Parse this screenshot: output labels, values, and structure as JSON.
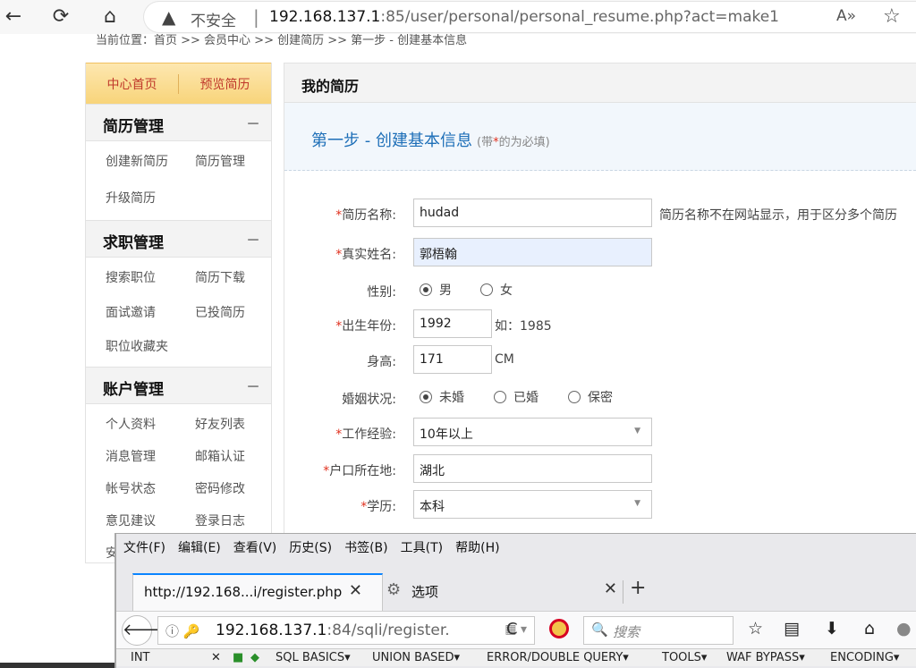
{
  "edge": {
    "back": "←",
    "refresh": "⟳",
    "home": "⌂",
    "warning": "▲",
    "insecure": "不安全",
    "separator": "|",
    "url_host": "192.168.137.1",
    "url_rest": ":85/user/personal/personal_resume.php?act=make1",
    "read_aloud": "A»",
    "favorite": "☆"
  },
  "breadcrumb": "当前位置：首页 >> 会员中心 >> 创建简历 >> 第一步 - 创建基本信息",
  "sidebar": {
    "top_links": [
      "中心首页",
      "预览简历"
    ],
    "sections": [
      {
        "title": "简历管理",
        "toggle": "－",
        "items": [
          "创建新简历",
          "简历管理",
          "升级简历"
        ]
      },
      {
        "title": "求职管理",
        "toggle": "－",
        "items": [
          "搜索职位",
          "简历下载",
          "面试邀请",
          "已投简历",
          "职位收藏夹"
        ]
      },
      {
        "title": "账户管理",
        "toggle": "－",
        "items": [
          "个人资料",
          "好友列表",
          "消息管理",
          "邮箱认证",
          "帐号状态",
          "密码修改",
          "意见建议",
          "登录日志",
          "安"
        ]
      }
    ]
  },
  "main": {
    "title": "我的简历",
    "step_title": "第一步 - 创建基本信息",
    "step_note_open": "(带",
    "step_note_star": "*",
    "step_note_close": "的为必填)"
  },
  "form": {
    "star": "*",
    "resume_name": {
      "label": "简历名称:",
      "value": "hudad",
      "hint": "简历名称不在网站显示，用于区分多个简历"
    },
    "real_name": {
      "label": "真实姓名:",
      "value": "郭梧翰"
    },
    "gender": {
      "label": "性别:",
      "options": [
        "男",
        "女"
      ],
      "selected": "男"
    },
    "birth_year": {
      "label": "出生年份:",
      "value": "1992",
      "hint": "如：1985"
    },
    "height": {
      "label": "身高:",
      "value": "171",
      "unit": "CM"
    },
    "marital": {
      "label": "婚姻状况:",
      "options": [
        "未婚",
        "已婚",
        "保密"
      ],
      "selected": "未婚"
    },
    "experience": {
      "label": "工作经验:",
      "value": "10年以上"
    },
    "hukou": {
      "label": "户口所在地:",
      "value": "湖北"
    },
    "education": {
      "label": "学历:",
      "value": "本科"
    }
  },
  "firefox": {
    "menu": [
      "文件(F)",
      "编辑(E)",
      "查看(V)",
      "历史(S)",
      "书签(B)",
      "工具(T)",
      "帮助(H)"
    ],
    "tab_active": "http://192.168...i/register.php",
    "tab_close": "✕",
    "tab2_icon": "⚙",
    "tab2": "选项",
    "new_tab": "+",
    "back": "🡐",
    "info_icons": "ⓘ 🔑",
    "url_host": "192.168.137.1",
    "url_rest": ":84/sqli/register.",
    "url_extra": "▦ ▾",
    "reload": "C",
    "search_icon": "🔍",
    "search_placeholder": "搜索",
    "toolbar_icons": [
      "☆",
      "▤",
      "⬇",
      "⌂",
      "●"
    ],
    "hackbar": [
      "INT",
      "✕",
      "■",
      "◆",
      "SQL BASICS▾",
      "UNION BASED▾",
      "ERROR/DOUBLE QUERY▾",
      "TOOLS▾",
      "WAF BYPASS▾",
      "ENCODING▾"
    ]
  }
}
